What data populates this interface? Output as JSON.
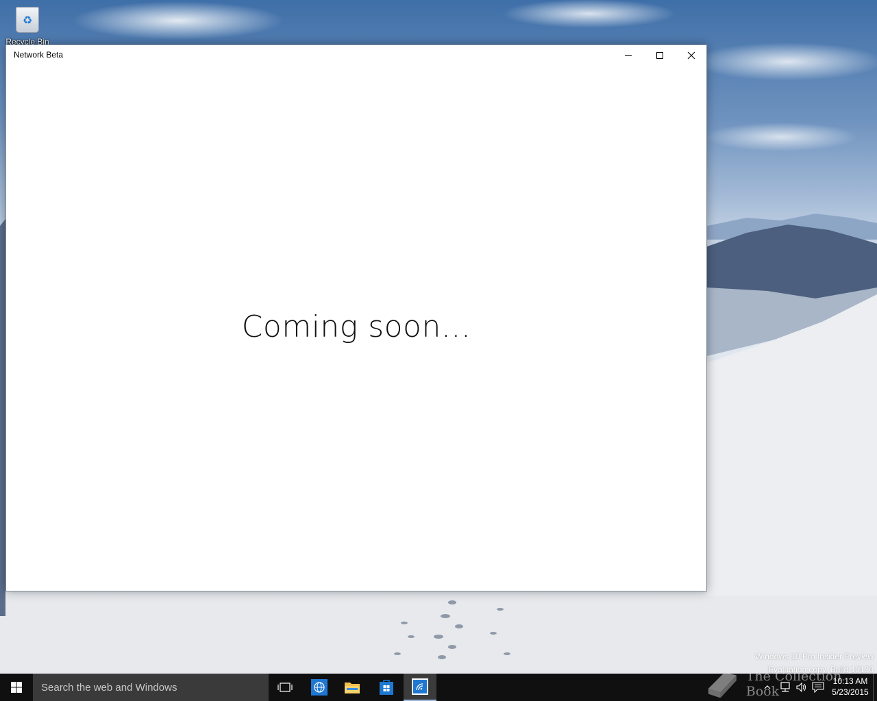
{
  "desktop": {
    "recycle_bin": {
      "label": "Recycle Bin",
      "icon": "recycle-bin-icon"
    }
  },
  "window": {
    "title": "Network Beta",
    "controls": {
      "minimize": "minimize-icon",
      "maximize": "maximize-icon",
      "close": "close-icon"
    },
    "message": "Coming soon..."
  },
  "watermark": {
    "line1": "Windows 10 Pro Insider Preview",
    "line2": "Evaluation copy. Build 10130"
  },
  "overlay_logo": {
    "text": "The Collection Book",
    "icon": "book-icon"
  },
  "taskbar": {
    "search_placeholder": "Search the web and Windows",
    "pinned": [
      {
        "name": "task-view",
        "icon": "task-view-icon"
      },
      {
        "name": "browser",
        "icon": "globe-icon"
      },
      {
        "name": "file-explorer",
        "icon": "folder-icon"
      },
      {
        "name": "store",
        "icon": "store-icon"
      },
      {
        "name": "network-beta",
        "icon": "network-beta-icon"
      }
    ],
    "clock": {
      "time": "10:13 AM",
      "date": "5/23/2015"
    },
    "accent_color": "#1e78d2"
  }
}
